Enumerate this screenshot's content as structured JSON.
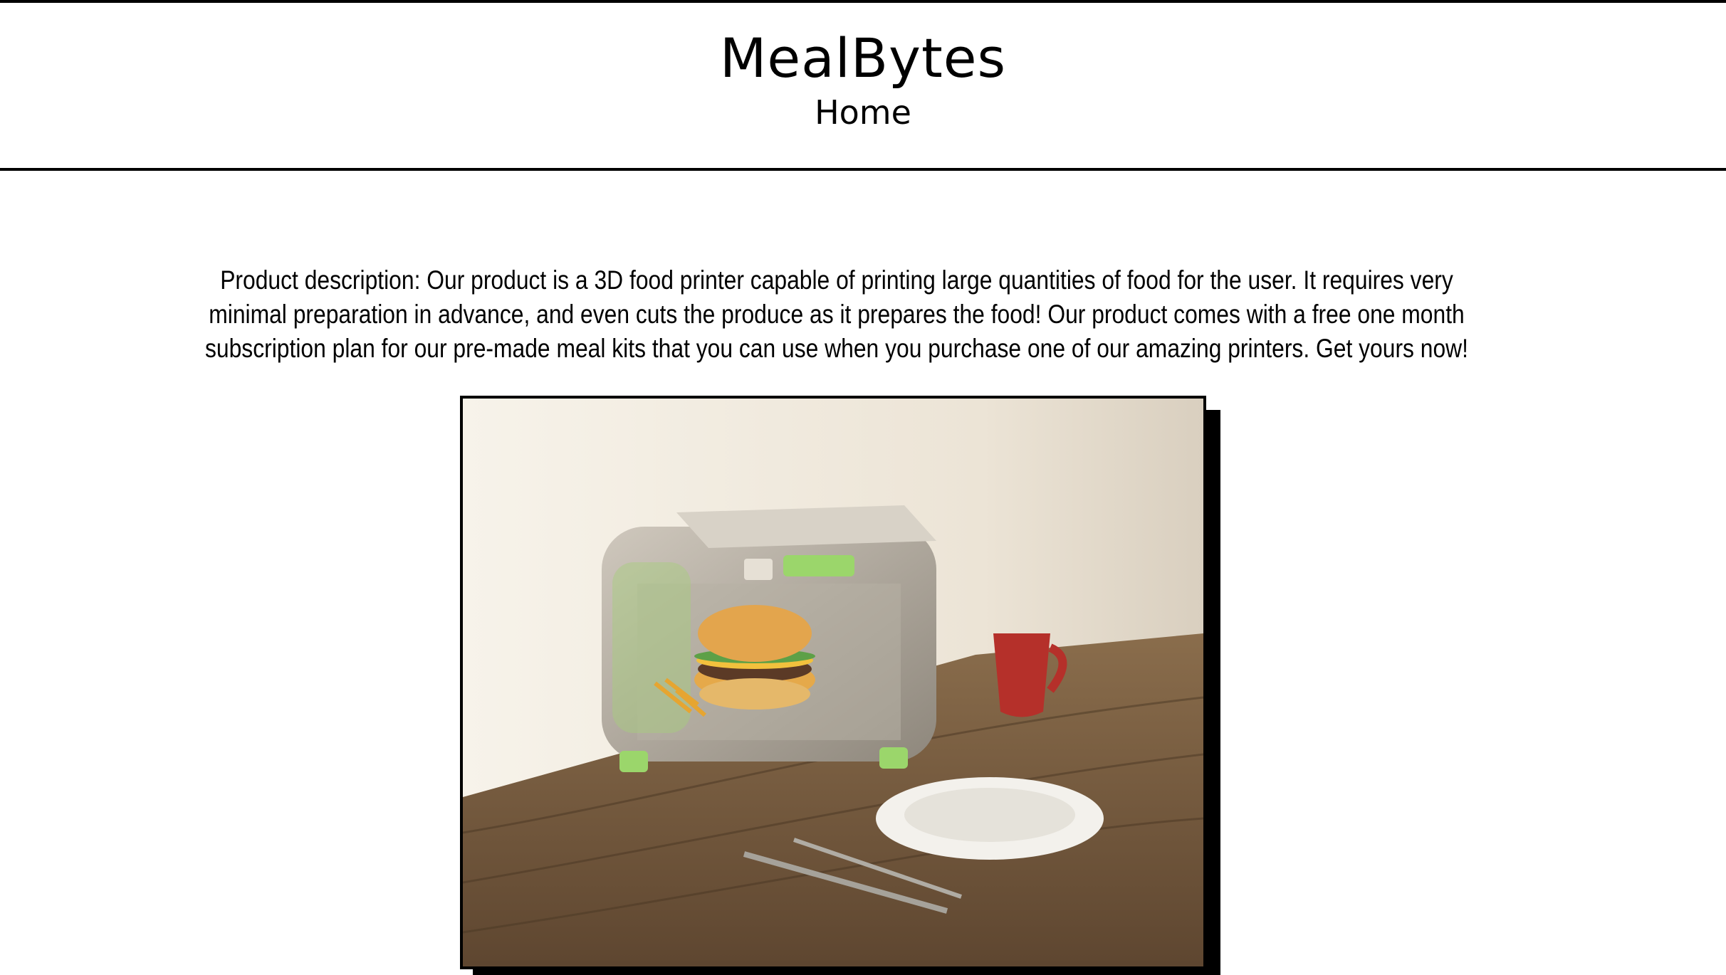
{
  "header": {
    "brand": "MealBytes",
    "nav_home": "Home"
  },
  "main": {
    "description": "Product description: Our product is a 3D food printer capable of printing large quantities of food for the user. It requires very minimal preparation in advance, and even cuts the produce as it prepares the food! Our product comes with a free one month subscription plan for our pre-made meal kits that you can use when you purchase one of our amazing printers. Get yours now!"
  },
  "colors": {
    "border": "#000000",
    "accent_green": "#9bd66b",
    "mug_red": "#b5302a",
    "table_wood": "#6b5236"
  }
}
